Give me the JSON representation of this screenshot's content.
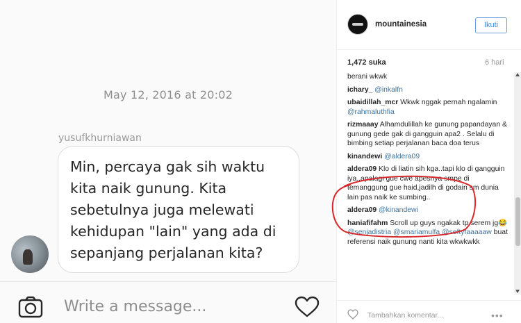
{
  "dm": {
    "timestamp": "May 12, 2016 at 20:02",
    "sender": "yusufkhurniawan",
    "message": "Min, percaya gak sih waktu kita naik gunung. Kita sebetulnya juga melewati kehidupan \"lain\" yang ada di sepanjang perjalanan kita?",
    "compose_placeholder": "Write a message..."
  },
  "post": {
    "username": "mountainesia",
    "follow_label": "Ikuti",
    "likes": "1,472 suka",
    "age": "6 hari",
    "add_comment_placeholder": "Tambahkan komentar...",
    "more_label": "•••"
  },
  "comments": [
    {
      "user": "",
      "pre": "berani wkwk",
      "mention": "",
      "post": ""
    },
    {
      "user": "ichary_",
      "pre": " ",
      "mention": "@inkalfn",
      "post": ""
    },
    {
      "user": "ubaidillah_mcr",
      "pre": " Wkwk nggak pernah ngalamin ",
      "mention": "@rahmaluthfia",
      "post": ""
    },
    {
      "user": "rizmaaay",
      "pre": " Alhamdulillah ke gunung papandayan & gunung gede gak di gangguin apa2 . Selalu di bimbing setiap perjalanan baca doa terus",
      "mention": "",
      "post": ""
    },
    {
      "user": "kinandewi",
      "pre": " ",
      "mention": "@aldera09",
      "post": ""
    },
    {
      "user": "aldera09",
      "pre": " Klo di liatin sih kga..tapi klo di gangguin iya..apalagi gue cwe apesnya smpe di temanggung gue haid,jadilh di godain sm dunia lain pas naik ke sumbing..",
      "mention": "",
      "post": ""
    },
    {
      "user": "aldera09",
      "pre": " ",
      "mention": "@kinandewi",
      "post": ""
    },
    {
      "user": "haniafifahm",
      "pre": " Scroll up guys ngakak tp serem jg😂 ",
      "mention": "@senjadistria @smariamulfa @seftyfaaaaaw",
      "post": " buat referensi naik gunung nanti kita wkwkwkk"
    }
  ],
  "colors": {
    "follow_blue": "#3f8ada",
    "mention_blue": "#3f729b",
    "annotation_red": "#d8282c"
  },
  "icons": {
    "camera": "camera-icon",
    "heart": "heart-icon",
    "scroll_up": "scroll-up-arrow-icon",
    "scroll_down": "scroll-down-arrow-icon"
  }
}
